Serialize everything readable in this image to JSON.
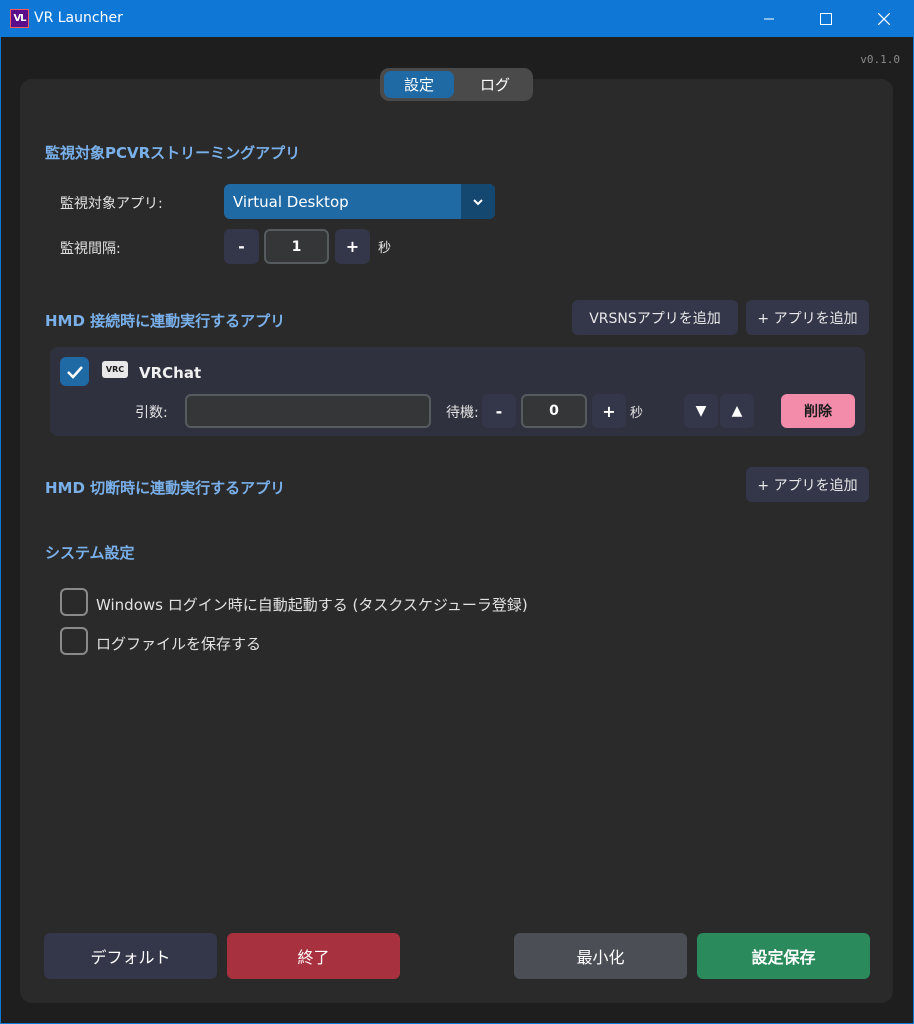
{
  "window": {
    "logo_text": "VL",
    "title": "VR Launcher",
    "version": "v0.1.0"
  },
  "tabs": [
    {
      "label": "設定",
      "active": true
    },
    {
      "label": "ログ",
      "active": false
    }
  ],
  "monitor": {
    "title": "監視対象PCVRストリーミングアプリ",
    "app_label": "監視対象アプリ:",
    "app_value": "Virtual Desktop",
    "interval_label": "監視間隔:",
    "minus": "-",
    "interval_value": "1",
    "plus": "+",
    "unit": "秒"
  },
  "connect": {
    "title": "HMD 接続時に連動実行するアプリ",
    "add_vrsns": "VRSNSアプリを追加",
    "add_app": "+ アプリを追加",
    "apps": [
      {
        "icon_text": "VRC",
        "name": "VRChat",
        "enabled": true,
        "args_label": "引数:",
        "args_value": "",
        "wait_label": "待機:",
        "minus": "-",
        "wait_value": "0",
        "plus": "+",
        "unit": "秒",
        "down": "▼",
        "up": "▲",
        "delete": "削除"
      }
    ]
  },
  "disconnect": {
    "title": "HMD 切断時に連動実行するアプリ",
    "add_app": "+ アプリを追加"
  },
  "system": {
    "title": "システム設定",
    "autostart": {
      "label": "Windows ログイン時に自動起動する (タスクスケジューラ登録)",
      "checked": false
    },
    "save_log": {
      "label": "ログファイルを保存する",
      "checked": false
    }
  },
  "footer": {
    "default": "デフォルト",
    "exit": "終了",
    "minimize": "最小化",
    "save": "設定保存"
  },
  "colors": {
    "accent": "#1f6aa5",
    "danger": "#a8313f",
    "success": "#2b8a5c",
    "delete": "#f28caa",
    "section_title": "#7ab0ea"
  }
}
